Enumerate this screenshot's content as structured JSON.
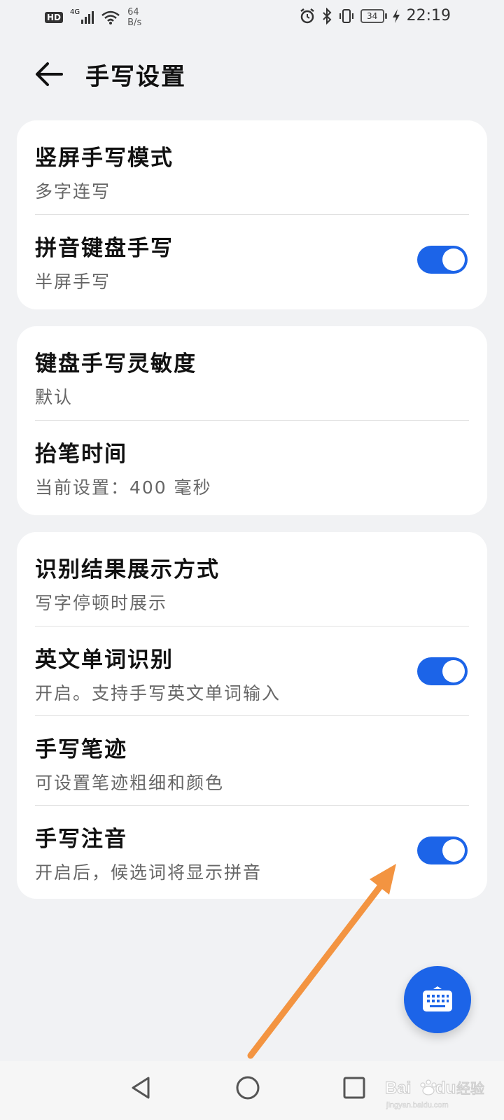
{
  "status_bar": {
    "hd": "HD",
    "network": "4G",
    "speed_value": "64",
    "speed_unit": "B/s",
    "battery": "34",
    "time": "22:19"
  },
  "header": {
    "back_icon": "arrow-left-icon",
    "title": "手写设置"
  },
  "groups": [
    {
      "items": [
        {
          "title": "竖屏手写模式",
          "subtitle": "多字连写"
        },
        {
          "title": "拼音键盘手写",
          "subtitle": "半屏手写",
          "toggle": true
        }
      ]
    },
    {
      "items": [
        {
          "title": "键盘手写灵敏度",
          "subtitle": "默认"
        },
        {
          "title": "抬笔时间",
          "subtitle": "当前设置：400 毫秒"
        }
      ]
    },
    {
      "items": [
        {
          "title": "识别结果展示方式",
          "subtitle": "写字停顿时展示"
        },
        {
          "title": "英文单词识别",
          "subtitle": "开启。支持手写英文单词输入",
          "toggle": true
        },
        {
          "title": "手写笔迹",
          "subtitle": "可设置笔迹粗细和颜色"
        },
        {
          "title": "手写注音",
          "subtitle": "开启后，候选词将显示拼音",
          "toggle": true
        }
      ]
    }
  ],
  "fab": {
    "icon": "keyboard-icon"
  },
  "annotation": {
    "icon": "arrow-annotation",
    "color": "#f39441"
  },
  "navbar": {
    "back": "triangle-back-icon",
    "home": "circle-home-icon",
    "recents": "square-recents-icon"
  },
  "watermark": {
    "brand": "Bai du 经验",
    "url": "jingyan.baidu.com"
  },
  "colors": {
    "accent": "#1c64e8",
    "background": "#f1f2f4",
    "card": "#ffffff"
  }
}
